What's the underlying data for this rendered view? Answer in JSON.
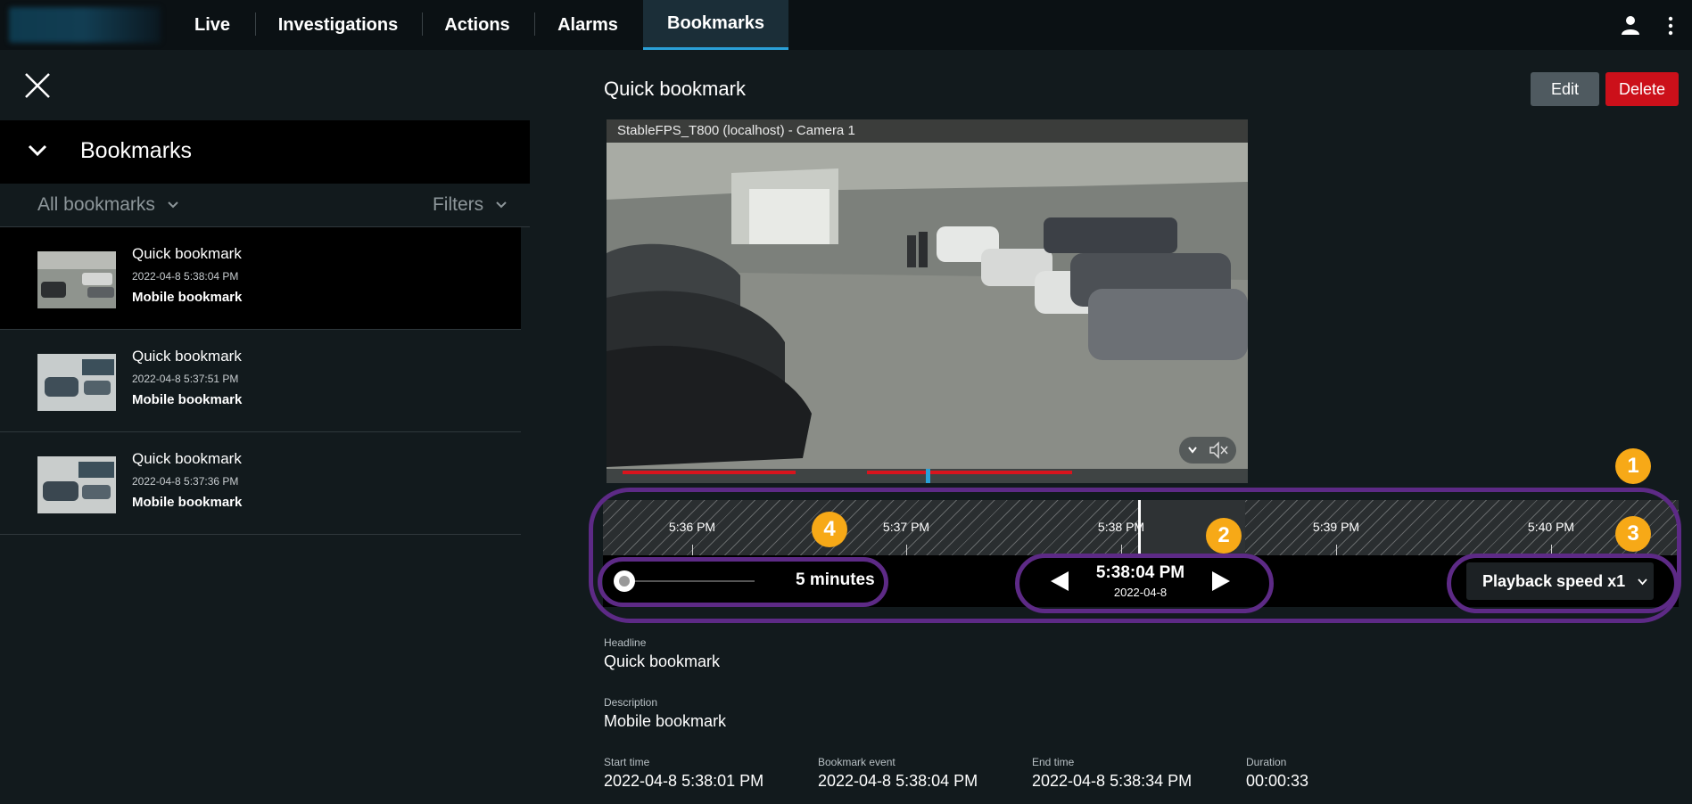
{
  "nav": {
    "tabs": [
      {
        "label": "Live"
      },
      {
        "label": "Investigations"
      },
      {
        "label": "Actions"
      },
      {
        "label": "Alarms"
      },
      {
        "label": "Bookmarks",
        "active": true
      }
    ],
    "icons": {
      "user": "user-icon",
      "more": "more-vertical-icon"
    }
  },
  "sidebar": {
    "title": "Bookmarks",
    "filter_all": "All bookmarks",
    "filters_label": "Filters",
    "items": [
      {
        "name": "Quick bookmark",
        "date": "2022-04-8 5:38:04 PM",
        "description": "Mobile bookmark",
        "selected": true
      },
      {
        "name": "Quick bookmark",
        "date": "2022-04-8 5:37:51 PM",
        "description": "Mobile bookmark"
      },
      {
        "name": "Quick bookmark",
        "date": "2022-04-8 5:37:36 PM",
        "description": "Mobile bookmark"
      }
    ]
  },
  "detail": {
    "title": "Quick bookmark",
    "edit_label": "Edit",
    "delete_label": "Delete",
    "camera_label": "StableFPS_T800 (localhost) - Camera 1"
  },
  "timeline": {
    "ticks": [
      "5:36 PM",
      "5:37 PM",
      "5:38 PM",
      "5:39 PM",
      "5:40 PM"
    ],
    "zoom_label": "5 minutes",
    "current_time": "5:38:04 PM",
    "current_date": "2022-04-8",
    "speed_label": "Playback speed x1"
  },
  "annotations": [
    "1",
    "2",
    "3",
    "4"
  ],
  "metadata": {
    "headline_label": "Headline",
    "headline": "Quick bookmark",
    "description_label": "Description",
    "description": "Mobile bookmark",
    "start_label": "Start time",
    "start": "2022-04-8 5:38:01 PM",
    "event_label": "Bookmark event",
    "event": "2022-04-8 5:38:04 PM",
    "end_label": "End time",
    "end": "2022-04-8 5:38:34 PM",
    "duration_label": "Duration",
    "duration": "00:00:33"
  },
  "colors": {
    "accent": "#2aa0d8",
    "delete": "#cc101a",
    "annotation_ring": "#5d2a86",
    "annotation_marker": "#f7a917"
  }
}
